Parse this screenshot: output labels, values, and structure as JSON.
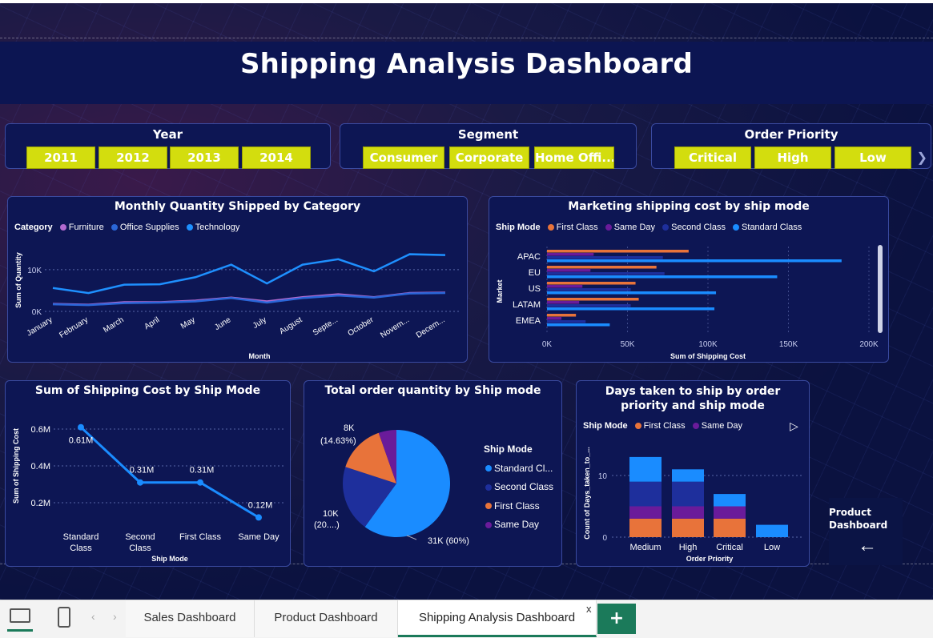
{
  "title": "Shipping Analysis Dashboard",
  "slicers": {
    "year": {
      "title": "Year",
      "items": [
        "2011",
        "2012",
        "2013",
        "2014"
      ]
    },
    "segment": {
      "title": "Segment",
      "items": [
        "Consumer",
        "Corporate",
        "Home Offi..."
      ]
    },
    "priority": {
      "title": "Order Priority",
      "items": [
        "Critical",
        "High",
        "Low"
      ]
    }
  },
  "colors": {
    "accent_chip": "#d3dd0e",
    "furniture": "#b36ad0",
    "office_supplies": "#2a66d8",
    "technology": "#1e90ff",
    "first_class": "#e8733a",
    "same_day": "#6a1b9a",
    "second_class": "#1e2f9c",
    "standard_class": "#1a8cff"
  },
  "charts": {
    "monthly": {
      "title": "Monthly Quantity Shipped by Category",
      "legend_title": "Category",
      "legend": [
        "Furniture",
        "Office Supplies",
        "Technology"
      ]
    },
    "marketing": {
      "title": "Marketing shipping cost by ship mode",
      "legend_title": "Ship Mode",
      "legend": [
        "First Class",
        "Same Day",
        "Second Class",
        "Standard Class"
      ]
    },
    "shipcost": {
      "title": "Sum of Shipping Cost by Ship Mode"
    },
    "pie": {
      "title": "Total order quantity by Ship mode",
      "legend_title": "Ship Mode",
      "legend": [
        "Standard Cl...",
        "Second Class",
        "First Class",
        "Same Day"
      ]
    },
    "days": {
      "title": "Days taken to ship by order priority and ship mode",
      "legend_title": "Ship Mode",
      "legend": [
        "First Class",
        "Same Day"
      ]
    }
  },
  "chart_data": [
    {
      "type": "line",
      "title": "Monthly Quantity Shipped by Category",
      "xlabel": "Month",
      "ylabel": "Sum of Quantity",
      "categories": [
        "January",
        "February",
        "March",
        "April",
        "May",
        "June",
        "July",
        "August",
        "Septe...",
        "October",
        "Novem...",
        "Decem..."
      ],
      "y_ticks": [
        "0K",
        "10K"
      ],
      "ylim": [
        0,
        14000
      ],
      "series": [
        {
          "name": "Furniture",
          "values": [
            1800,
            1600,
            2200,
            2200,
            2600,
            3300,
            2400,
            3400,
            4100,
            3400,
            4400,
            4500
          ]
        },
        {
          "name": "Office Supplies",
          "values": [
            1700,
            1500,
            2000,
            2100,
            2400,
            3200,
            2100,
            3200,
            3800,
            3300,
            4300,
            4400
          ]
        },
        {
          "name": "Technology",
          "values": [
            5600,
            4400,
            6400,
            6500,
            8200,
            11200,
            6700,
            11200,
            12500,
            9600,
            13700,
            13500
          ]
        }
      ]
    },
    {
      "type": "bar",
      "orientation": "horizontal",
      "title": "Marketing shipping cost by ship mode",
      "xlabel": "Sum of Shipping Cost",
      "ylabel": "Market",
      "categories": [
        "APAC",
        "EU",
        "US",
        "LATAM",
        "EMEA"
      ],
      "x_ticks": [
        "0K",
        "50K",
        "100K",
        "150K",
        "200K"
      ],
      "xlim": [
        0,
        200000
      ],
      "series": [
        {
          "name": "First Class",
          "values": [
            88000,
            68000,
            55000,
            57000,
            18000
          ]
        },
        {
          "name": "Same Day",
          "values": [
            29000,
            27000,
            22000,
            20000,
            9000
          ]
        },
        {
          "name": "Second Class",
          "values": [
            72000,
            73000,
            52000,
            52000,
            24000
          ]
        },
        {
          "name": "Standard Class",
          "values": [
            183000,
            143000,
            105000,
            104000,
            39000
          ]
        }
      ]
    },
    {
      "type": "line",
      "title": "Sum of Shipping Cost by Ship Mode",
      "xlabel": "Ship Mode",
      "ylabel": "Sum of Shipping Cost",
      "categories": [
        "Standard Class",
        "Second Class",
        "First Class",
        "Same Day"
      ],
      "values": [
        0.61,
        0.31,
        0.31,
        0.12
      ],
      "data_labels": [
        "0.61M",
        "0.31M",
        "0.31M",
        "0.12M"
      ],
      "y_ticks": [
        "0.2M",
        "0.4M",
        "0.6M"
      ],
      "ylim": [
        0.1,
        0.65
      ]
    },
    {
      "type": "pie",
      "title": "Total order quantity by Ship mode",
      "categories": [
        "Standard Class",
        "Second Class",
        "First Class",
        "Same Day"
      ],
      "values": [
        60,
        20,
        14.63,
        5.37
      ],
      "data_labels": [
        "31K (60%)",
        "10K (20....)",
        "8K (14.63%)",
        ""
      ]
    },
    {
      "type": "bar",
      "stacked": true,
      "title": "Days taken to ship by order priority and ship mode",
      "xlabel": "Order Priority",
      "ylabel": "Count of Days_taken_to_...",
      "categories": [
        "Medium",
        "High",
        "Critical",
        "Low"
      ],
      "y_ticks": [
        "0",
        "10"
      ],
      "ylim": [
        0,
        14
      ],
      "series": [
        {
          "name": "First Class",
          "values": [
            3,
            3,
            3,
            0
          ]
        },
        {
          "name": "Same Day",
          "values": [
            2,
            2,
            2,
            0
          ]
        },
        {
          "name": "Second Class",
          "values": [
            4,
            4,
            0,
            0
          ]
        },
        {
          "name": "Standard Class",
          "values": [
            4,
            2,
            2,
            2
          ]
        }
      ]
    }
  ],
  "nav_button": {
    "label_line1": "Product",
    "label_line2": "Dashboard",
    "arrow": "←"
  },
  "tabbar": {
    "tabs": [
      "Sales Dashboard",
      "Product Dashboard",
      "Shipping Analysis Dashboard"
    ],
    "active_index": 2,
    "close_label": "x",
    "add_label": "+"
  }
}
